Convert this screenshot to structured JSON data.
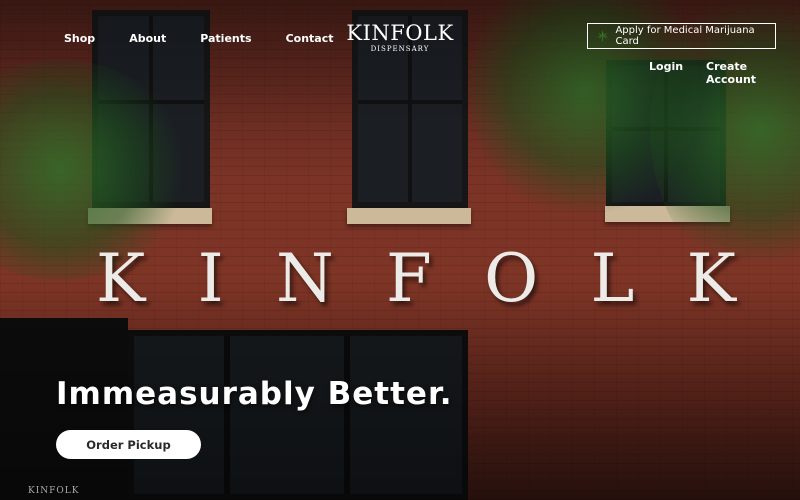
{
  "nav": {
    "items": [
      {
        "label": "Shop"
      },
      {
        "label": "About"
      },
      {
        "label": "Patients"
      },
      {
        "label": "Contact"
      }
    ]
  },
  "logo": {
    "name": "KINFOLK",
    "subtitle": "DISPENSARY"
  },
  "header": {
    "apply_label": "Apply for Medical Marijuana Card",
    "apply_icon": "cannabis-leaf-icon",
    "login_label": "Login",
    "create_account_label": "Create Account"
  },
  "hero": {
    "headline": "Immeasurably Better.",
    "cta_label": "Order Pickup",
    "wall_sign": [
      "K",
      "I",
      "N",
      "F",
      "O",
      "L",
      "K"
    ],
    "storefront_sign": "KINFOLK"
  },
  "colors": {
    "brick": "#7a3326",
    "text": "#ffffff",
    "cta_bg": "#ffffff",
    "cta_text": "#2a2a2a",
    "leaf_green": "#3a8a2a"
  }
}
